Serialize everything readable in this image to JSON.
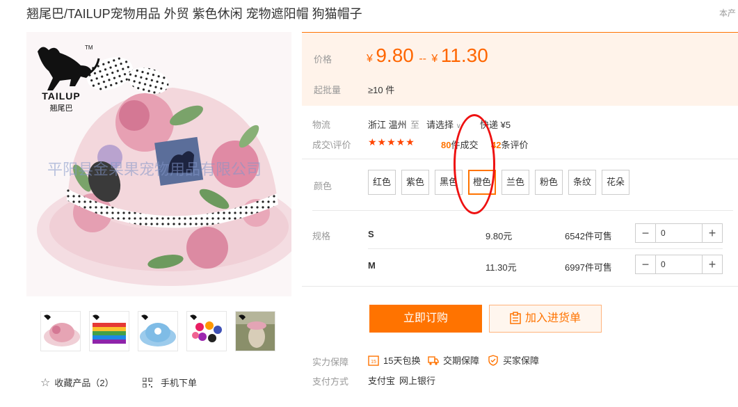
{
  "product": {
    "title": "翘尾巴/TAILUP宠物用品 外贸 紫色休闲 宠物遮阳帽 狗猫帽子",
    "corner_text": "本产",
    "brand_name": "TAILUP",
    "brand_sub": "翘尾巴",
    "brand_tm": "TM",
    "watermark": "平阳县金果果宠物用品有限公司"
  },
  "price": {
    "label": "价格",
    "currency": "¥",
    "low": "9.80",
    "separator": "--",
    "high": "11.30",
    "moq_label": "起批量",
    "moq_value": "≥10 件"
  },
  "logistics": {
    "label": "物流",
    "origin": "浙江 温州",
    "to": "至",
    "select": "请选择",
    "express": "快递 ¥5"
  },
  "deals": {
    "label": "成交\\评价",
    "stars": "★★★★★",
    "count": "80",
    "count_suffix": "件成交",
    "reviews": "42",
    "reviews_suffix": "条评价"
  },
  "colors": {
    "label": "颜色",
    "options": [
      "红色",
      "紫色",
      "黑色",
      "橙色",
      "兰色",
      "粉色",
      "条纹",
      "花朵"
    ],
    "selected": "橙色"
  },
  "specs": {
    "label": "规格",
    "rows": [
      {
        "size": "S",
        "price": "9.80元",
        "stock": "6542件可售",
        "qty": "0"
      },
      {
        "size": "M",
        "price": "11.30元",
        "stock": "6997件可售",
        "qty": "0"
      }
    ]
  },
  "actions": {
    "buy": "立即订购",
    "cart": "加入进货单"
  },
  "guarantee": {
    "label": "实力保障",
    "items": [
      "15天包换",
      "交期保障",
      "买家保障"
    ],
    "badge_15": "15"
  },
  "payment": {
    "label": "支付方式",
    "methods": [
      "支付宝",
      "网上银行"
    ]
  },
  "bottom": {
    "favorite": "收藏产品（2）",
    "mobile": "手机下单"
  },
  "colors_theme": {
    "accent": "#ff7300",
    "price": "#ff6600",
    "price_panel_bg": "#fff3ea",
    "annotation": "#ee1111"
  }
}
